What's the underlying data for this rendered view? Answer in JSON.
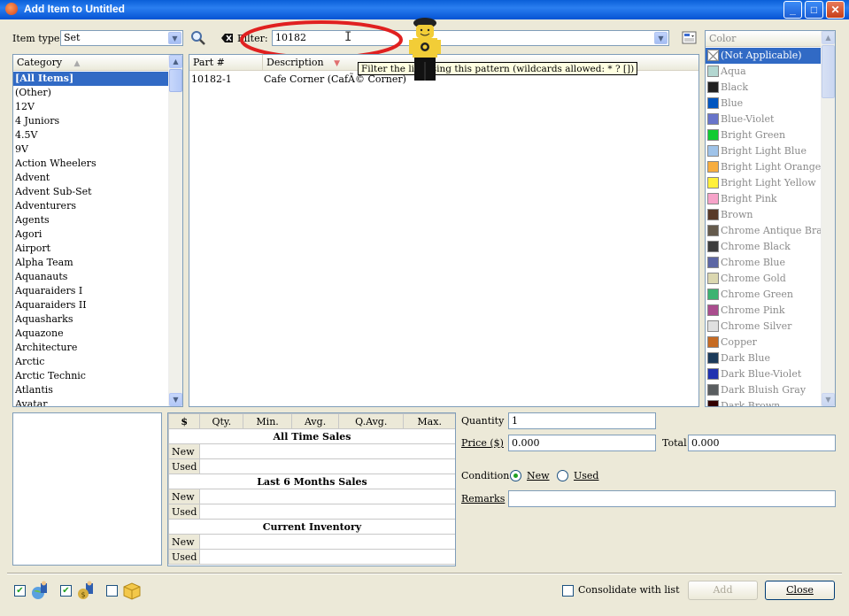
{
  "window": {
    "title": "Add Item to Untitled",
    "minimize": "_",
    "maximize": "□",
    "close": "✕"
  },
  "toolbar": {
    "item_type_label": "Item type:",
    "item_type_value": "Set",
    "filter_label": "Filter:",
    "filter_value": "10182",
    "filter_tooltip": "Filter the list using this pattern (wildcards allowed: * ? [])"
  },
  "category": {
    "header": "Category",
    "selected": "[All Items]",
    "items": [
      "[All Items]",
      "(Other)",
      "12V",
      "4 Juniors",
      "4.5V",
      "9V",
      "Action Wheelers",
      "Advent",
      "Advent Sub-Set",
      "Adventurers",
      "Agents",
      "Agori",
      "Airport",
      "Alpha Team",
      "Aquanauts",
      "Aquaraiders I",
      "Aquaraiders II",
      "Aquasharks",
      "Aquazone",
      "Architecture",
      "Arctic",
      "Arctic Technic",
      "Atlantis",
      "Avatar"
    ]
  },
  "items": {
    "headers": [
      "Part #",
      "Description"
    ],
    "rows": [
      {
        "part": "10182-1",
        "description": "Cafe Corner (CafÃ© Corner)"
      }
    ]
  },
  "colors": {
    "header": "Color",
    "items": [
      {
        "name": "(Not Applicable)",
        "hex": "#ffffff",
        "selected": true
      },
      {
        "name": "Aqua",
        "hex": "#b3d7d1"
      },
      {
        "name": "Black",
        "hex": "#212121"
      },
      {
        "name": "Blue",
        "hex": "#0055bf"
      },
      {
        "name": "Blue-Violet",
        "hex": "#6874ca"
      },
      {
        "name": "Bright Green",
        "hex": "#10cb31"
      },
      {
        "name": "Bright Light Blue",
        "hex": "#9fc3e9"
      },
      {
        "name": "Bright Light Orange",
        "hex": "#f7ad3f"
      },
      {
        "name": "Bright Light Yellow",
        "hex": "#fff03a"
      },
      {
        "name": "Bright Pink",
        "hex": "#f6a3c9"
      },
      {
        "name": "Brown",
        "hex": "#583927"
      },
      {
        "name": "Chrome Antique Brass",
        "hex": "#645a4c"
      },
      {
        "name": "Chrome Black",
        "hex": "#3c3c3c"
      },
      {
        "name": "Chrome Blue",
        "hex": "#5c66a4"
      },
      {
        "name": "Chrome Gold",
        "hex": "#dbd7b0"
      },
      {
        "name": "Chrome Green",
        "hex": "#3cb371"
      },
      {
        "name": "Chrome Pink",
        "hex": "#aa4d8e"
      },
      {
        "name": "Chrome Silver",
        "hex": "#e0e0e0"
      },
      {
        "name": "Copper",
        "hex": "#c66b23"
      },
      {
        "name": "Dark Blue",
        "hex": "#1b3a5a"
      },
      {
        "name": "Dark Blue-Violet",
        "hex": "#2032b0"
      },
      {
        "name": "Dark Bluish Gray",
        "hex": "#595d60"
      },
      {
        "name": "Dark Brown",
        "hex": "#330000"
      }
    ]
  },
  "stats": {
    "headers": [
      "$",
      "Qty.",
      "Min.",
      "Avg.",
      "Q.Avg.",
      "Max."
    ],
    "sections": [
      {
        "title": "All Time Sales",
        "rows": [
          "New",
          "Used"
        ]
      },
      {
        "title": "Last 6 Months Sales",
        "rows": [
          "New",
          "Used"
        ]
      },
      {
        "title": "Current Inventory",
        "rows": [
          "New",
          "Used"
        ]
      }
    ]
  },
  "form": {
    "quantity_label": "Quantity",
    "quantity_value": "1",
    "price_label": "Price ($)",
    "price_value": "0.000",
    "total_label": "Total",
    "total_value": "0.000",
    "condition_label": "Condition",
    "condition_new": "New",
    "condition_used": "Used",
    "remarks_label": "Remarks",
    "remarks_value": ""
  },
  "bottom": {
    "consolidate_label": "Consolidate with list",
    "add_label": "Add",
    "close_label": "Close"
  }
}
